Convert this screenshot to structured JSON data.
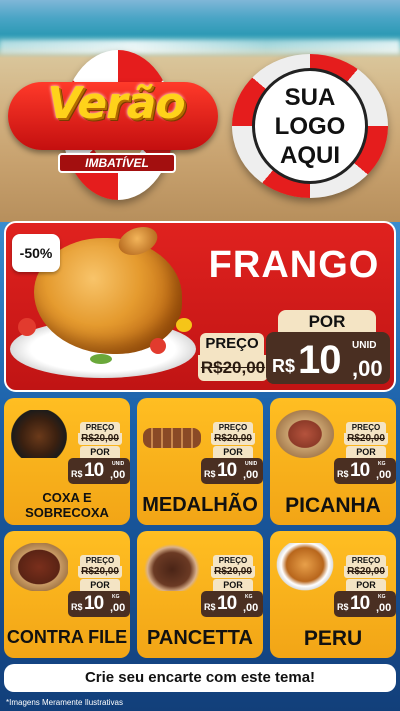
{
  "header": {
    "title": "Verão",
    "subtitle": "IMBATÍVEL",
    "logo_lines": [
      "SUA",
      "LOGO",
      "AQUI"
    ]
  },
  "featured": {
    "discount": "-50%",
    "name": "FRANGO",
    "preco_label": "PREÇO",
    "old_price": "R$20,00",
    "por_label": "POR",
    "currency": "R$",
    "price_int": "10",
    "price_dec": ",00",
    "unit": "UNID",
    "image": "roast-chicken"
  },
  "products": [
    {
      "name": "COXA E SOBRECOXA",
      "preco_label": "PREÇO",
      "old_price": "R$20,00",
      "por_label": "POR",
      "currency": "R$",
      "price_int": "10",
      "price_dec": ",00",
      "unit": "UNID",
      "image": "chicken-thigh"
    },
    {
      "name": "MEDALHÃO",
      "preco_label": "PREÇO",
      "old_price": "R$20,00",
      "por_label": "POR",
      "currency": "R$",
      "price_int": "10",
      "price_dec": ",00",
      "unit": "UNID",
      "image": "skewers"
    },
    {
      "name": "PICANHA",
      "preco_label": "PREÇO",
      "old_price": "R$20,00",
      "por_label": "POR",
      "currency": "R$",
      "price_int": "10",
      "price_dec": ",00",
      "unit": "KG",
      "image": "picanha"
    },
    {
      "name": "CONTRA FILE",
      "preco_label": "PREÇO",
      "old_price": "R$20,00",
      "por_label": "POR",
      "currency": "R$",
      "price_int": "10",
      "price_dec": ",00",
      "unit": "KG",
      "image": "steak"
    },
    {
      "name": "PANCETTA",
      "preco_label": "PREÇO",
      "old_price": "R$20,00",
      "por_label": "POR",
      "currency": "R$",
      "price_int": "10",
      "price_dec": ",00",
      "unit": "KG",
      "image": "pancetta"
    },
    {
      "name": "PERU",
      "preco_label": "PREÇO",
      "old_price": "R$20,00",
      "por_label": "POR",
      "currency": "R$",
      "price_int": "10",
      "price_dec": ",00",
      "unit": "KG",
      "image": "turkey"
    }
  ],
  "cta": "Crie seu encarte com este tema!",
  "footnote": "*Imagens Meramente Ilustrativas",
  "colors": {
    "red": "#e0221f",
    "yellow": "#ffbe22",
    "brown": "#4a2f22",
    "cream": "#f4e4c4"
  }
}
